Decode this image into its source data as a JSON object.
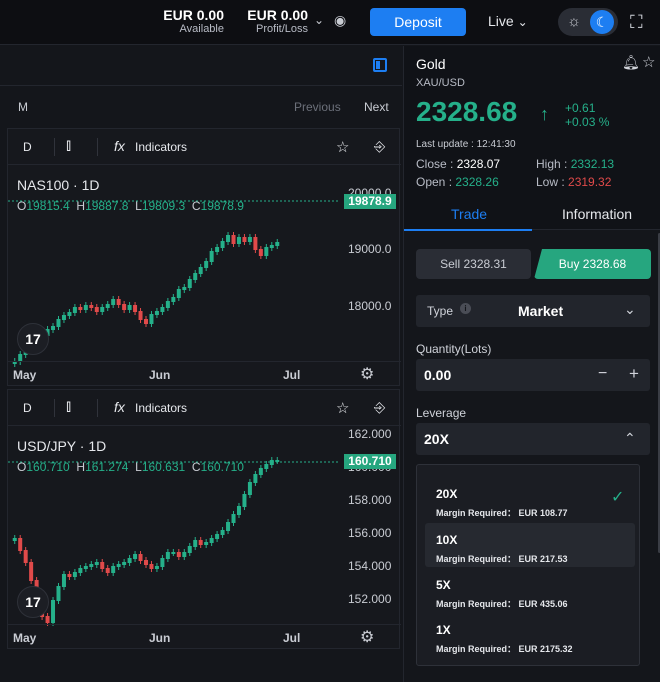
{
  "topbar": {
    "balance_value": "EUR 0.00",
    "balance_label": "Available",
    "pl_value": "EUR 0.00",
    "pl_label": "Profit/Loss",
    "deposit_label": "Deposit",
    "account_mode": "Live",
    "icons": [
      "chevron-down-icon",
      "eye-icon",
      "sun-icon",
      "moon-icon",
      "fullscreen-icon"
    ]
  },
  "nav": {
    "m_label": "M",
    "previous_label": "Previous",
    "next_label": "Next"
  },
  "charts": [
    {
      "timeframe": "D",
      "indicators_label": "Indicators",
      "title": "NAS100 · 1D",
      "o_label": "O",
      "o": "19815.4",
      "h_label": "H",
      "h": "19887.8",
      "l_label": "L",
      "l": "19809.3",
      "c_label": "C",
      "c": "19878.9",
      "last_price": "19878.9",
      "y_labels": [
        "20000.0",
        "19000.0",
        "18000.0"
      ],
      "x_labels": [
        "May",
        "Jun",
        "Jul"
      ],
      "logo": "17"
    },
    {
      "timeframe": "D",
      "indicators_label": "Indicators",
      "title": "USD/JPY · 1D",
      "o_label": "O",
      "o": "160.710",
      "h_label": "H",
      "h": "161.274",
      "l_label": "L",
      "l": "160.631",
      "c_label": "C",
      "c": "160.710",
      "last_price": "160.710",
      "y_labels": [
        "162.000",
        "160.000",
        "158.000",
        "156.000",
        "154.000",
        "152.000"
      ],
      "x_labels": [
        "May",
        "Jun",
        "Jul"
      ],
      "logo": "17"
    }
  ],
  "instrument": {
    "name": "Gold",
    "symbol": "XAU/USD",
    "price": "2328.68",
    "arrow": "↑",
    "change_abs": "+0.61",
    "change_pct": "+0.03 %",
    "last_update": "Last update : 12:41:30",
    "close_label": "Close :",
    "close": "2328.07",
    "open_label": "Open :",
    "open": "2328.26",
    "high_label": "High :",
    "high": "2332.13",
    "low_label": "Low :",
    "low": "2319.32"
  },
  "tabs": {
    "trade": "Trade",
    "information": "Information"
  },
  "trade": {
    "sell_label": "Sell 2328.31",
    "buy_label": "Buy 2328.68",
    "type_label": "Type",
    "type_value": "Market",
    "quantity_label": "Quantity(Lots)",
    "quantity_value": "0.00",
    "minus": "−",
    "plus": "+",
    "leverage_label": "Leverage",
    "leverage_value": "20X"
  },
  "leverage_options": [
    {
      "label": "20X",
      "margin": "Margin Required： EUR 108.77",
      "selected": true
    },
    {
      "label": "10X",
      "margin": "Margin Required： EUR 217.53",
      "selected": false
    },
    {
      "label": "5X",
      "margin": "Margin Required： EUR 435.06",
      "selected": false
    },
    {
      "label": "1X",
      "margin": "Margin Required： EUR 2175.32",
      "selected": false
    }
  ],
  "colors": {
    "up": "#25b08a",
    "down": "#e04a4a",
    "accent": "#1d7ef2"
  }
}
